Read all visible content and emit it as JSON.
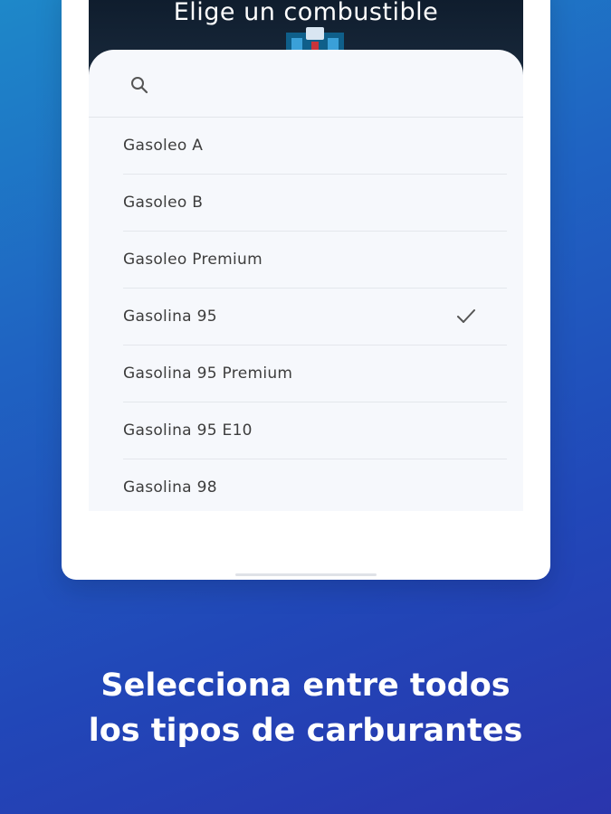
{
  "header": {
    "title": "Elige un combustible"
  },
  "search": {
    "placeholder": ""
  },
  "fuels": [
    {
      "label": "Gasoleo A",
      "selected": false
    },
    {
      "label": "Gasoleo B",
      "selected": false
    },
    {
      "label": "Gasoleo Premium",
      "selected": false
    },
    {
      "label": "Gasolina 95",
      "selected": true
    },
    {
      "label": "Gasolina 95 Premium",
      "selected": false
    },
    {
      "label": "Gasolina 95 E10",
      "selected": false
    },
    {
      "label": "Gasolina 98",
      "selected": false
    }
  ],
  "caption": {
    "line1": "Selecciona entre todos",
    "line2": "los tipos de carburantes"
  },
  "colors": {
    "background_start": "#1e88c9",
    "background_end": "#2a35ad",
    "sheet": "#f6f8fc",
    "check": "#555555"
  },
  "icons": {
    "search": "search-icon",
    "selected": "check-icon"
  }
}
